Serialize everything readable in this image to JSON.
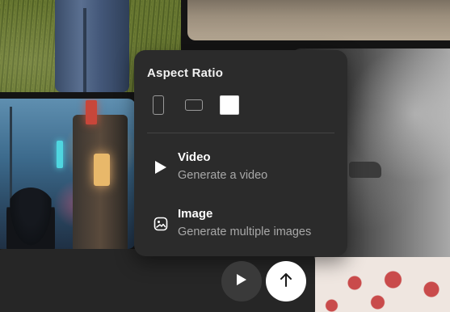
{
  "popover": {
    "title": "Aspect Ratio",
    "ratios": [
      {
        "name": "portrait",
        "selected": false
      },
      {
        "name": "landscape",
        "selected": false
      },
      {
        "name": "square",
        "selected": true
      }
    ],
    "items": [
      {
        "label": "Video",
        "description": "Generate a video",
        "icon": "play-icon"
      },
      {
        "label": "Image",
        "description": "Generate multiple images",
        "icon": "image-icon"
      }
    ]
  },
  "actions": {
    "play_icon": "play-icon",
    "upload_icon": "arrow-up-icon"
  },
  "colors": {
    "popover_bg": "#2b2b2b",
    "text_primary": "#ffffff",
    "text_secondary": "#a8a8a8",
    "upload_button_bg": "#ffffff",
    "play_button_bg": "#3a3a3a"
  }
}
